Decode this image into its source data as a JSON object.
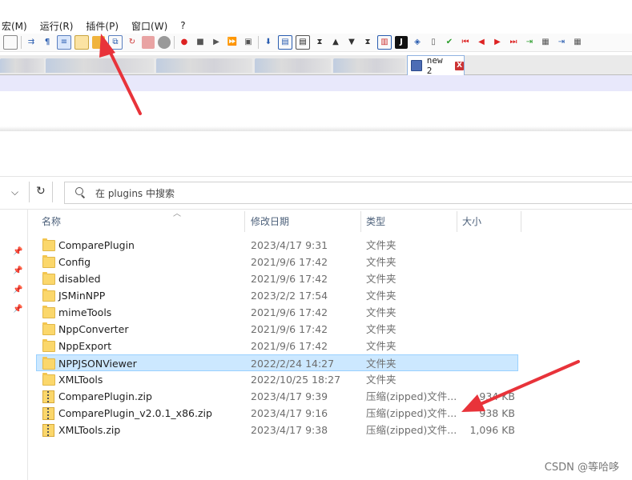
{
  "npp": {
    "menu": [
      "宏(M)",
      "运行(R)",
      "插件(P)",
      "窗口(W)",
      "?"
    ],
    "active_tab": "new 2",
    "tab_close": "X"
  },
  "explorer": {
    "search_placeholder": "在 plugins 中搜索",
    "columns": {
      "name": "名称",
      "date": "修改日期",
      "type": "类型",
      "size": "大小"
    },
    "rows": [
      {
        "name": "ComparePlugin",
        "date": "2023/4/17 9:31",
        "type": "文件夹",
        "size": "",
        "kind": "folder"
      },
      {
        "name": "Config",
        "date": "2021/9/6 17:42",
        "type": "文件夹",
        "size": "",
        "kind": "folder"
      },
      {
        "name": "disabled",
        "date": "2021/9/6 17:42",
        "type": "文件夹",
        "size": "",
        "kind": "folder"
      },
      {
        "name": "JSMinNPP",
        "date": "2023/2/2 17:54",
        "type": "文件夹",
        "size": "",
        "kind": "folder"
      },
      {
        "name": "mimeTools",
        "date": "2021/9/6 17:42",
        "type": "文件夹",
        "size": "",
        "kind": "folder"
      },
      {
        "name": "NppConverter",
        "date": "2021/9/6 17:42",
        "type": "文件夹",
        "size": "",
        "kind": "folder"
      },
      {
        "name": "NppExport",
        "date": "2021/9/6 17:42",
        "type": "文件夹",
        "size": "",
        "kind": "folder"
      },
      {
        "name": "NPPJSONViewer",
        "date": "2022/2/24 14:27",
        "type": "文件夹",
        "size": "",
        "kind": "folder",
        "selected": true
      },
      {
        "name": "XMLTools",
        "date": "2022/10/25 18:27",
        "type": "文件夹",
        "size": "",
        "kind": "folder"
      },
      {
        "name": "ComparePlugin.zip",
        "date": "2023/4/17 9:39",
        "type": "压缩(zipped)文件...",
        "size": "934 KB",
        "kind": "zip"
      },
      {
        "name": "ComparePlugin_v2.0.1_x86.zip",
        "date": "2023/4/17 9:16",
        "type": "压缩(zipped)文件...",
        "size": "938 KB",
        "kind": "zip"
      },
      {
        "name": "XMLTools.zip",
        "date": "2023/4/17 9:38",
        "type": "压缩(zipped)文件...",
        "size": "1,096 KB",
        "kind": "zip"
      }
    ]
  },
  "watermark": "CSDN @等哈哆",
  "colors": {
    "annotation_red": "#e8333a",
    "selection": "#cce8ff"
  }
}
